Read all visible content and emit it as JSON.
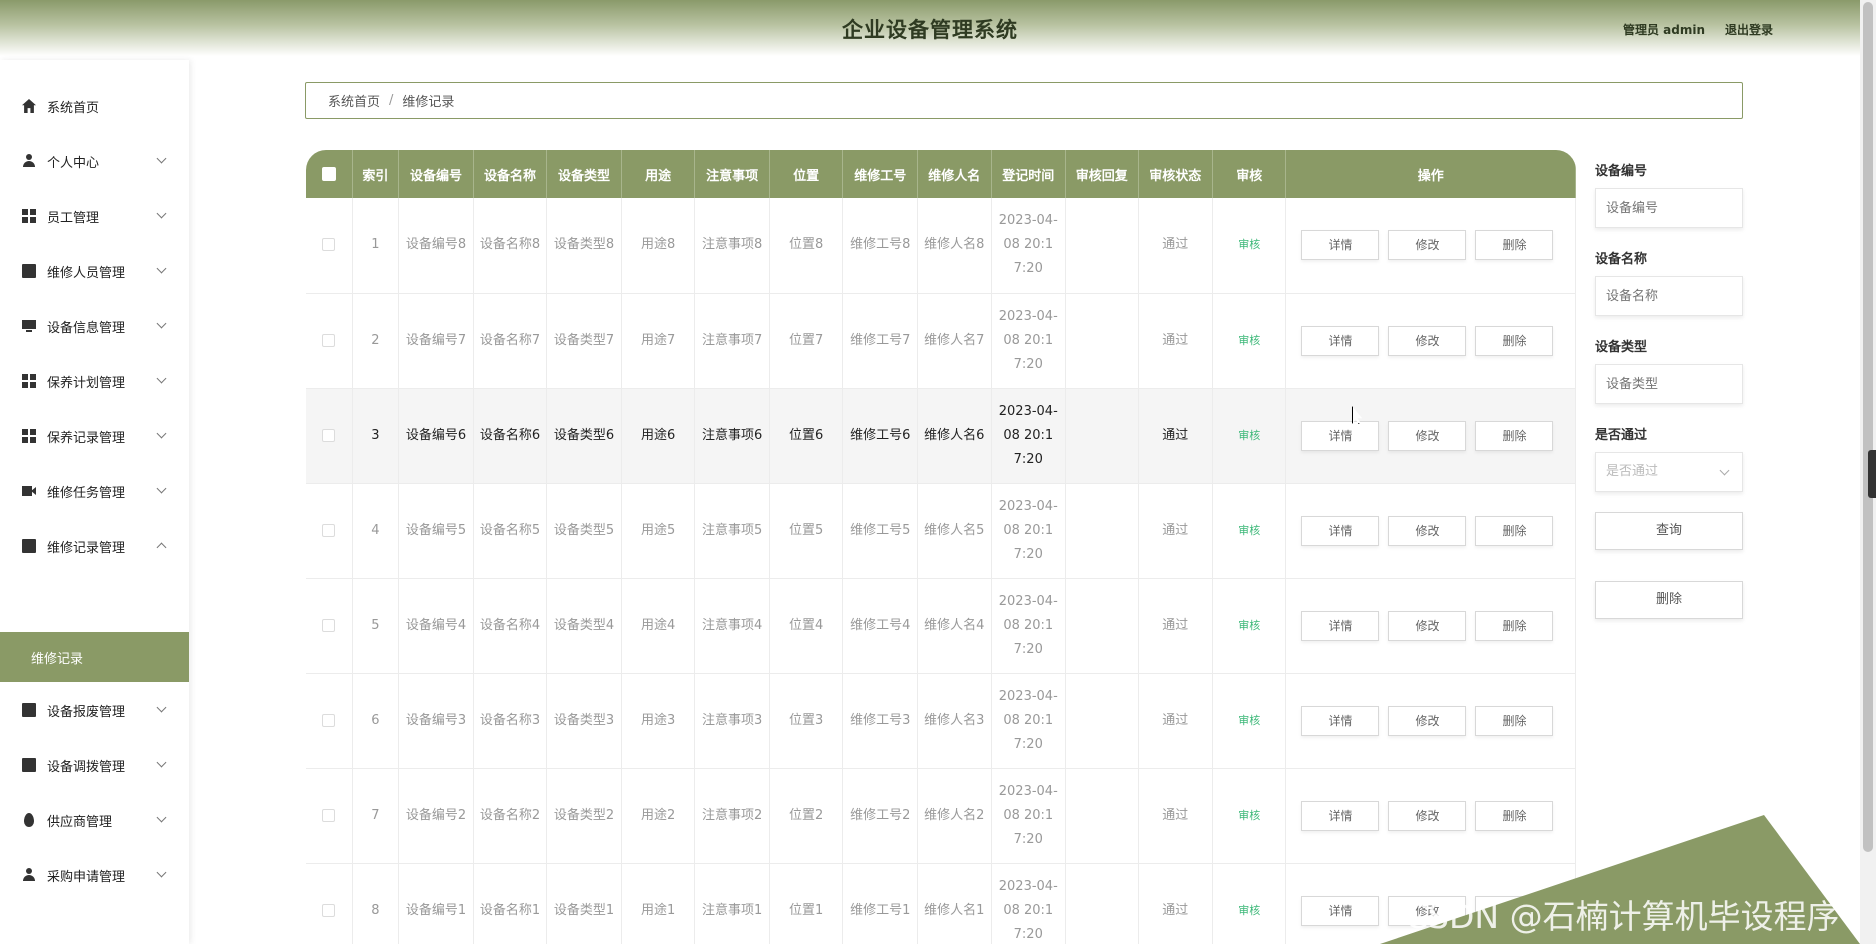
{
  "header": {
    "title": "企业设备管理系统",
    "user": "管理员 admin",
    "logout": "退出登录"
  },
  "sidebar": {
    "items": [
      {
        "label": "系统首页",
        "icon": "home-icon",
        "expandable": false
      },
      {
        "label": "个人中心",
        "icon": "user-icon",
        "expandable": true
      },
      {
        "label": "员工管理",
        "icon": "grid-icon",
        "expandable": true
      },
      {
        "label": "维修人员管理",
        "icon": "clipboard-icon",
        "expandable": true
      },
      {
        "label": "设备信息管理",
        "icon": "monitor-icon",
        "expandable": true
      },
      {
        "label": "保养计划管理",
        "icon": "grid-icon",
        "expandable": true
      },
      {
        "label": "保养记录管理",
        "icon": "grid-icon",
        "expandable": true
      },
      {
        "label": "维修任务管理",
        "icon": "video-icon",
        "expandable": true
      },
      {
        "label": "维修记录管理",
        "icon": "folder-icon",
        "expandable": true,
        "expanded": true
      },
      {
        "label": "设备报废管理",
        "icon": "clipboard-icon",
        "expandable": true
      },
      {
        "label": "设备调拨管理",
        "icon": "checklist-icon",
        "expandable": true
      },
      {
        "label": "供应商管理",
        "icon": "pin-icon",
        "expandable": true
      },
      {
        "label": "采购申请管理",
        "icon": "user-icon",
        "expandable": true
      }
    ],
    "active_sub": "维修记录"
  },
  "breadcrumb": {
    "home": "系统首页",
    "separator": "/",
    "current": "维修记录"
  },
  "table": {
    "headers": [
      "索引",
      "设备编号",
      "设备名称",
      "设备类型",
      "用途",
      "注意事项",
      "位置",
      "维修工号",
      "维修人名",
      "登记时间",
      "审核回复",
      "审核状态",
      "审核",
      "操作"
    ],
    "rows": [
      {
        "index": "1",
        "code": "设备编号8",
        "name": "设备名称8",
        "type": "设备类型8",
        "use": "用途8",
        "note": "注意事项8",
        "loc": "位置8",
        "wno": "维修工号8",
        "wname": "维修人名8",
        "time": "2023-04-08 20:17:20",
        "reply": "",
        "status": "通过",
        "audit": "审核"
      },
      {
        "index": "2",
        "code": "设备编号7",
        "name": "设备名称7",
        "type": "设备类型7",
        "use": "用途7",
        "note": "注意事项7",
        "loc": "位置7",
        "wno": "维修工号7",
        "wname": "维修人名7",
        "time": "2023-04-08 20:17:20",
        "reply": "",
        "status": "通过",
        "audit": "审核"
      },
      {
        "index": "3",
        "code": "设备编号6",
        "name": "设备名称6",
        "type": "设备类型6",
        "use": "用途6",
        "note": "注意事项6",
        "loc": "位置6",
        "wno": "维修工号6",
        "wname": "维修人名6",
        "time": "2023-04-08 20:17:20",
        "reply": "",
        "status": "通过",
        "audit": "审核"
      },
      {
        "index": "4",
        "code": "设备编号5",
        "name": "设备名称5",
        "type": "设备类型5",
        "use": "用途5",
        "note": "注意事项5",
        "loc": "位置5",
        "wno": "维修工号5",
        "wname": "维修人名5",
        "time": "2023-04-08 20:17:20",
        "reply": "",
        "status": "通过",
        "audit": "审核"
      },
      {
        "index": "5",
        "code": "设备编号4",
        "name": "设备名称4",
        "type": "设备类型4",
        "use": "用途4",
        "note": "注意事项4",
        "loc": "位置4",
        "wno": "维修工号4",
        "wname": "维修人名4",
        "time": "2023-04-08 20:17:20",
        "reply": "",
        "status": "通过",
        "audit": "审核"
      },
      {
        "index": "6",
        "code": "设备编号3",
        "name": "设备名称3",
        "type": "设备类型3",
        "use": "用途3",
        "note": "注意事项3",
        "loc": "位置3",
        "wno": "维修工号3",
        "wname": "维修人名3",
        "time": "2023-04-08 20:17:20",
        "reply": "",
        "status": "通过",
        "audit": "审核"
      },
      {
        "index": "7",
        "code": "设备编号2",
        "name": "设备名称2",
        "type": "设备类型2",
        "use": "用途2",
        "note": "注意事项2",
        "loc": "位置2",
        "wno": "维修工号2",
        "wname": "维修人名2",
        "time": "2023-04-08 20:17:20",
        "reply": "",
        "status": "通过",
        "audit": "审核"
      },
      {
        "index": "8",
        "code": "设备编号1",
        "name": "设备名称1",
        "type": "设备类型1",
        "use": "用途1",
        "note": "注意事项1",
        "loc": "位置1",
        "wno": "维修工号1",
        "wname": "维修人名1",
        "time": "2023-04-08 20:17:20",
        "reply": "",
        "status": "通过",
        "audit": "审核"
      }
    ],
    "row_actions": {
      "detail": "详情",
      "edit": "修改",
      "delete": "删除"
    }
  },
  "filters": {
    "code": {
      "label": "设备编号",
      "placeholder": "设备编号"
    },
    "name": {
      "label": "设备名称",
      "placeholder": "设备名称"
    },
    "type": {
      "label": "设备类型",
      "placeholder": "设备类型"
    },
    "pass": {
      "label": "是否通过",
      "placeholder": "是否通过"
    },
    "search_button": "查询",
    "delete_button": "删除"
  },
  "watermark": "CSDN @石楠计算机毕设程序",
  "colors": {
    "accent": "#8a9a66",
    "audit_link": "#3cb878"
  }
}
